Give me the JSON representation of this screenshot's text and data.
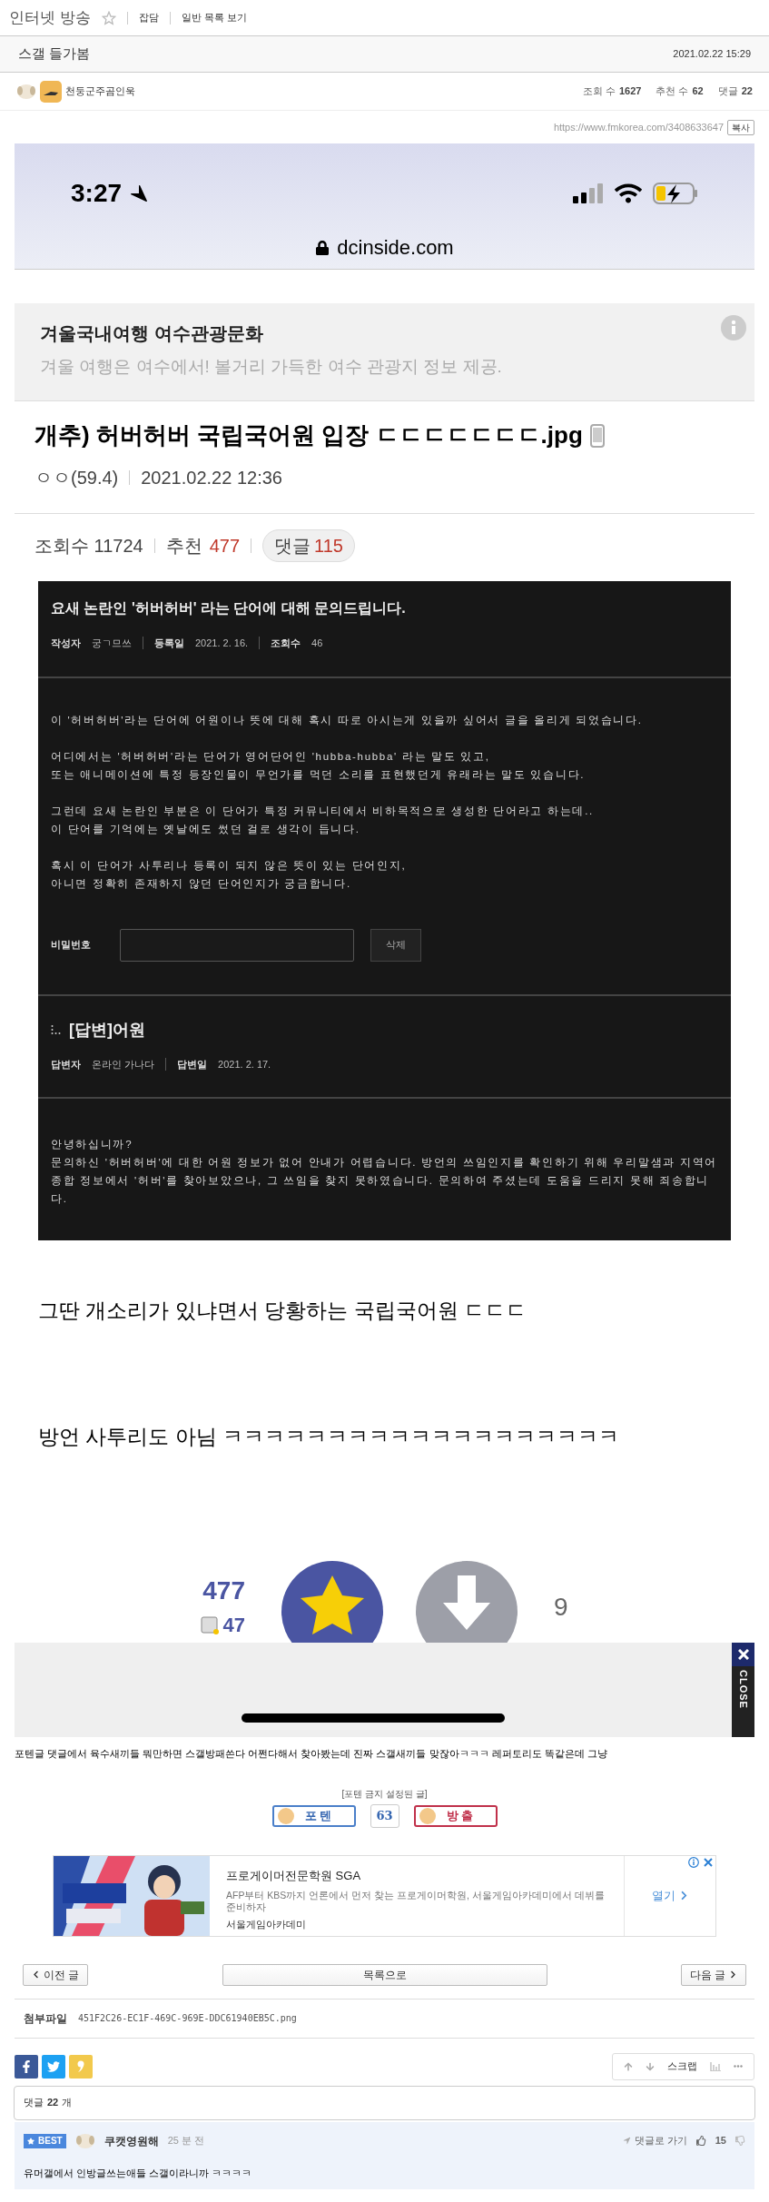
{
  "header": {
    "board": "인터넷 방송",
    "favorite": false,
    "links": [
      "잡담",
      "일반 목록 보기"
    ]
  },
  "post": {
    "title": "스갤 들가봄",
    "date": "2021.02.22 15:29",
    "author": "천둥군주곰인욱",
    "stats": [
      {
        "label": "조회 수",
        "value": "1627"
      },
      {
        "label": "추천 수",
        "value": "62"
      },
      {
        "label": "댓글",
        "value": "22"
      }
    ],
    "url": "https://www.fmkorea.com/3408633647",
    "copy_button": "복사"
  },
  "capture": {
    "time": "3:27",
    "domain": "dcinside.com",
    "ad": {
      "title": "겨울국내여행 여수관광문화",
      "text": "겨울 여행은 여수에서! 볼거리 가득한 여수 관광지 정보 제공."
    },
    "title": "개추) 허버허버 국립국어원 입장 ㄷㄷㄷㄷㄷㄷㄷ.jpg",
    "author": "ㅇㅇ(59.4)",
    "date": "2021.02.22 12:36",
    "views_label": "조회수 11724",
    "recommend_label": "추천",
    "recommend": "477",
    "comments_label": "댓글",
    "comments": "115",
    "inquiry": {
      "title": "요새 논란인 '허버허버' 라는 단어에 대해 문의드립니다.",
      "meta": [
        {
          "label": "작성자",
          "value": "궁ㄱ므쓰"
        },
        {
          "label": "등록일",
          "value": "2021. 2. 16."
        },
        {
          "label": "조회수",
          "value": "46"
        }
      ],
      "paragraphs": [
        "이 '허버허버'라는 단어에 어원이나 뜻에 대해 혹시 따로 아시는게 있을까 싶어서 글을 올리게 되었습니다.",
        "어디에서는 '허버허버'라는 단어가 영어단어인 'hubba-hubba' 라는 말도 있고,\n또는 애니메이션에 특정 등장인물이 무언가를 먹던 소리를 표현했던게 유래라는 말도 있습니다.",
        "그런데 요새 논란인 부분은 이 단어가 특정 커뮤니티에서 비하목적으로 생성한 단어라고 하는데..\n이 단어를 기억에는 옛날에도 썼던 걸로 생각이 듭니다.",
        "혹시 이 단어가 사투리나 등록이 되지 않은 뜻이 있는 단어인지,\n아니면 정확히 존재하지 않던 단어인지가 궁금합니다."
      ],
      "password_label": "비밀번호",
      "delete_button": "삭제"
    },
    "answer": {
      "title": "[답변]어원",
      "meta": [
        {
          "label": "답변자",
          "value": "온라인 가나다"
        },
        {
          "label": "답변일",
          "value": "2021. 2. 17."
        }
      ],
      "text": "안녕하십니까?\n문의하신 '허버허버'에 대한 어원 정보가 없어 안내가 어렵습니다. 방언의 쓰임인지를 확인하기 위해 우리말샘과 지역어 종합 정보에서 '허버'를 찾아보았으나, 그 쓰임을 찾지 못하였습니다. 문의하여 주셨는데 도움을 드리지 못해 죄송합니다."
    },
    "caption1": "그딴 개소리가 있냐면서 당황하는 국립국어원 ㄷㄷㄷ",
    "caption2": "방언 사투리도 아님 ㅋㅋㅋㅋㅋㅋㅋㅋㅋㅋㅋㅋㅋㅋㅋㅋㅋㅋㅋ",
    "upvotes": "477",
    "sub_votes": "47",
    "downvotes": "9"
  },
  "overlay_close": "CLOSE",
  "body_text": "포텐글 댓글에서 육수새끼들 뭐만하면 스갤방패쓴다 어쩐다해서 찾아봤는데 진짜 스갤새끼들 맞잖아ㅋㅋㅋ 레퍼토리도 똑같은데 그냥",
  "vote": {
    "notice": "[포텐 금지 설정된 글]",
    "up": "포 텐",
    "count": "63",
    "down": "방 출"
  },
  "ad": {
    "title": "프로게이머전문학원 SGA",
    "text": "AFP부터 KBS까지 언론에서 먼저 찾는 프로게이머학원, 서울게임아카데미에서 데뷔를 준비하자",
    "source": "서울게임아카데미",
    "button": "열기"
  },
  "nav": {
    "prev": "이전 글",
    "list": "목록으로",
    "next": "다음 글"
  },
  "attachment": {
    "label": "첨부파일",
    "file": "451F2C26-EC1F-469C-969E-DDC61940EB5C.png"
  },
  "scrap": "스크랩",
  "comments": {
    "label": "댓글",
    "count": "22",
    "unit": "개",
    "items": [
      {
        "best": true,
        "badge": "BEST",
        "author": "쿠캣영원해",
        "time": "25 분 전",
        "goto": "댓글로 가기",
        "likes": "15",
        "text": "유머갤에서 인방글쓰는애들 스갤이라니까 ㅋㅋㅋㅋ"
      }
    ]
  }
}
